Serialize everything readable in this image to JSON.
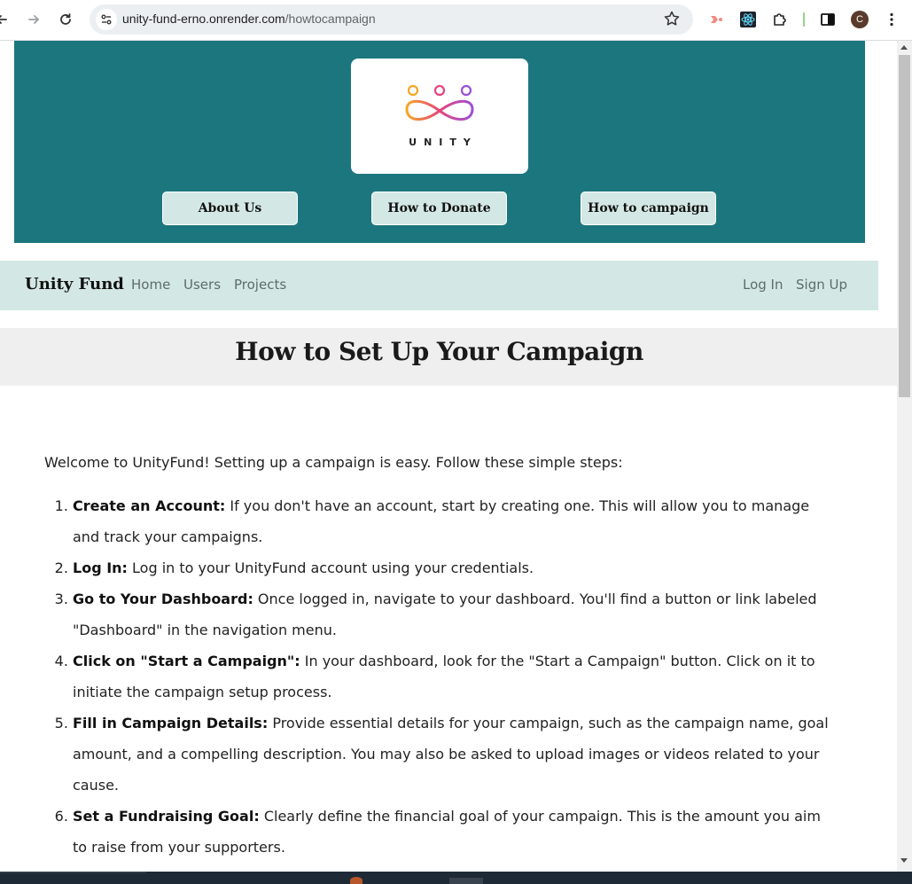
{
  "browser": {
    "url_host": "unity-fund-erno.onrender.com",
    "url_path": "/howtocampaign",
    "profile_initial": "C"
  },
  "hero": {
    "logo_text": "UNITY",
    "buttons": [
      {
        "label": "About Us"
      },
      {
        "label": "How to Donate"
      },
      {
        "label": "How to campaign"
      }
    ]
  },
  "navbar": {
    "brand": "Unity Fund",
    "left_links": [
      "Home",
      "Users",
      "Projects"
    ],
    "right_links": [
      "Log In",
      "Sign Up"
    ]
  },
  "page": {
    "title": "How to Set Up Your Campaign",
    "intro": "Welcome to UnityFund! Setting up a campaign is easy. Follow these simple steps:",
    "steps": [
      {
        "heading": "Create an Account:",
        "text": " If you don't have an account, start by creating one. This will allow you to manage and track your campaigns."
      },
      {
        "heading": "Log In:",
        "text": " Log in to your UnityFund account using your credentials."
      },
      {
        "heading": "Go to Your Dashboard:",
        "text": " Once logged in, navigate to your dashboard. You'll find a button or link labeled \"Dashboard\" in the navigation menu."
      },
      {
        "heading": "Click on \"Start a Campaign\":",
        "text": " In your dashboard, look for the \"Start a Campaign\" button. Click on it to initiate the campaign setup process."
      },
      {
        "heading": "Fill in Campaign Details:",
        "text": " Provide essential details for your campaign, such as the campaign name, goal amount, and a compelling description. You may also be asked to upload images or videos related to your cause."
      },
      {
        "heading": "Set a Fundraising Goal:",
        "text": " Clearly define the financial goal of your campaign. This is the amount you aim to raise from your supporters."
      }
    ]
  },
  "colors": {
    "hero_bg": "#1c767d",
    "navbar_bg": "#d3e8e4",
    "title_band_bg": "#efefef"
  }
}
